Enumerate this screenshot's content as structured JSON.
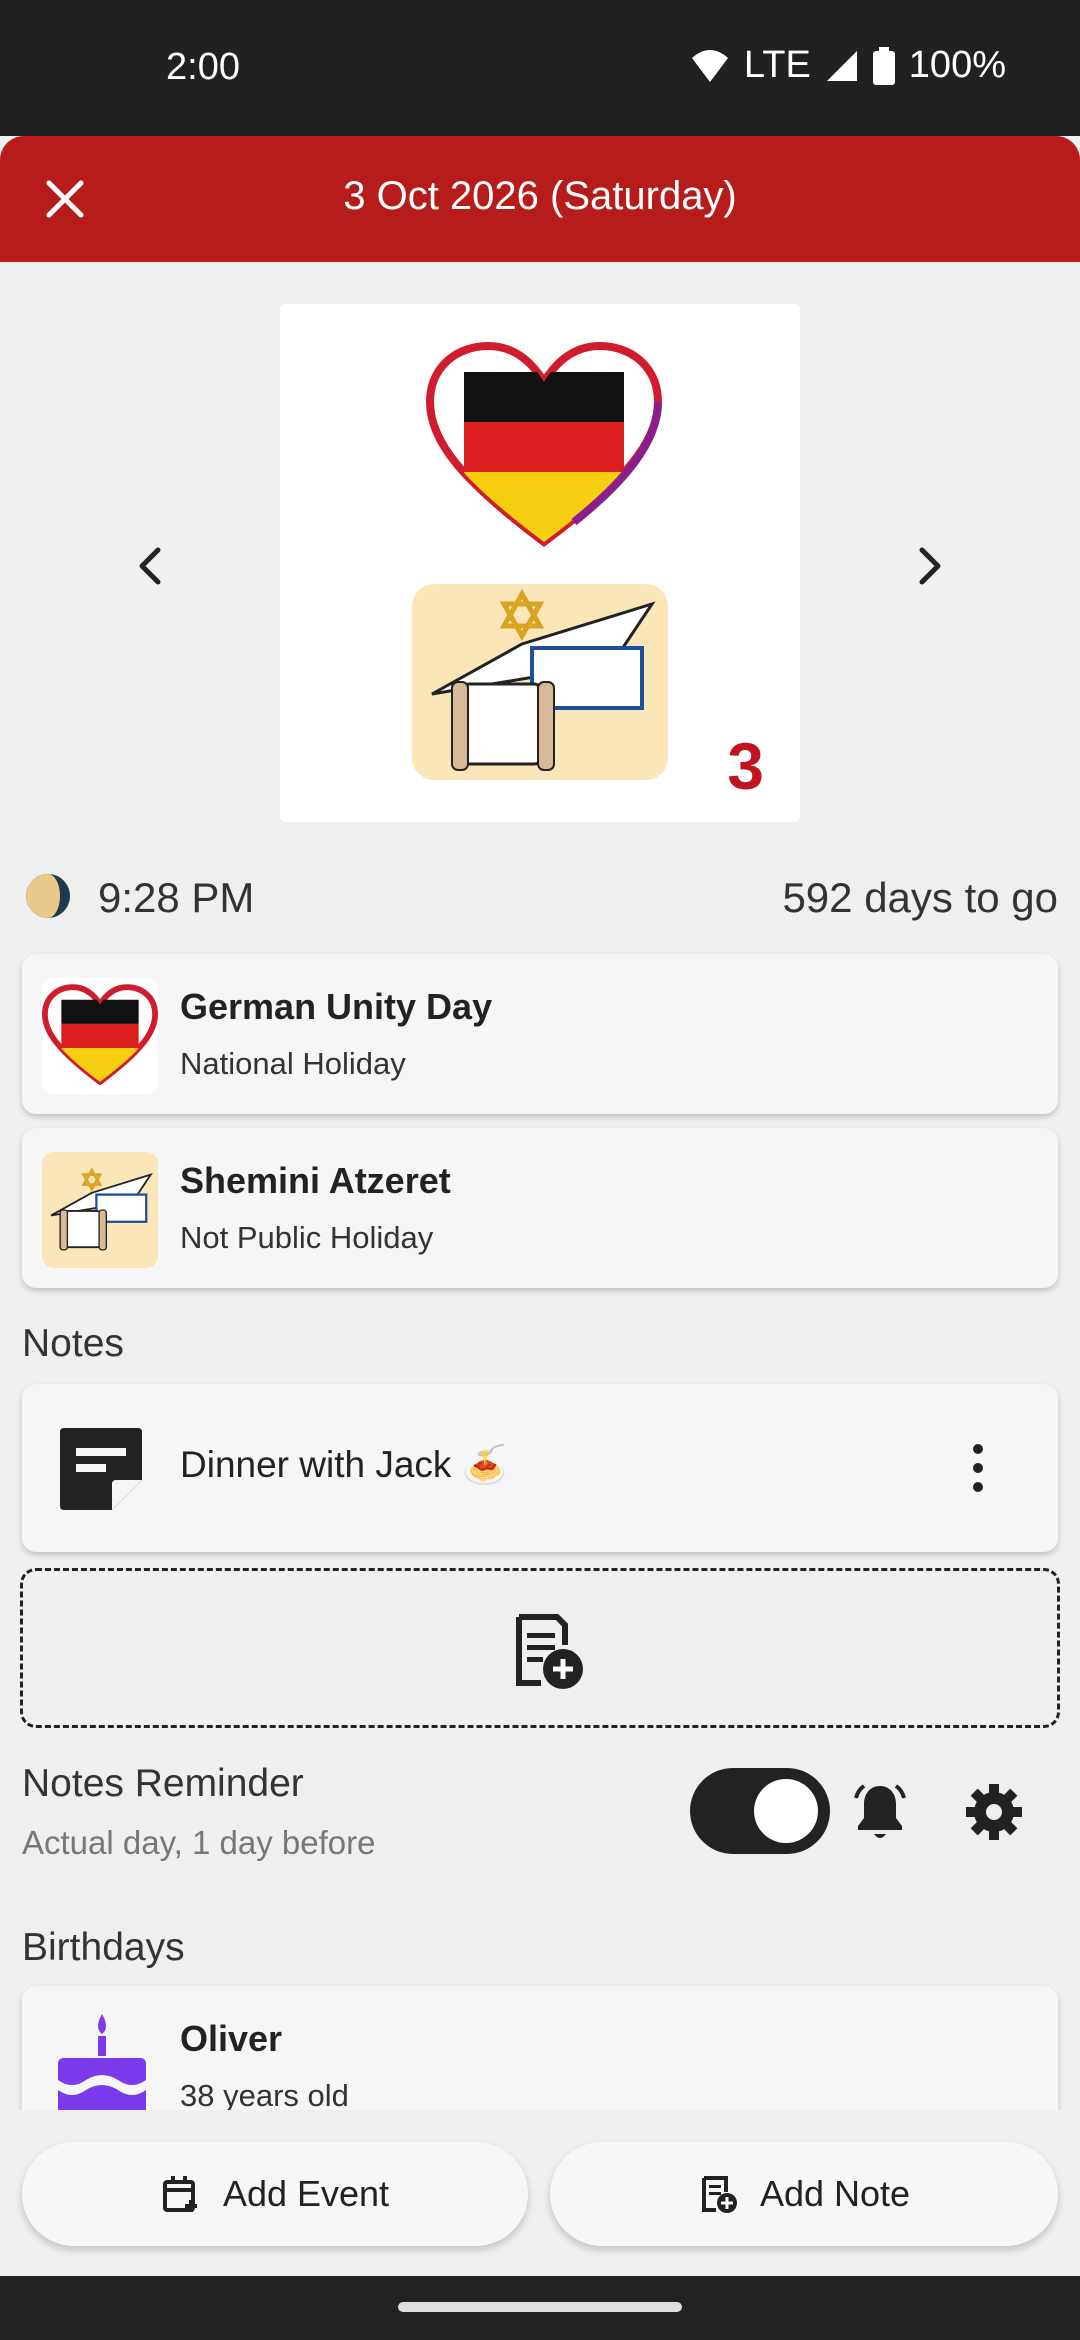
{
  "status_bar": {
    "time": "2:00",
    "network": "LTE",
    "battery": "100%"
  },
  "header": {
    "title": "3 Oct 2026 (Saturday)",
    "close_icon": "close-icon"
  },
  "hero": {
    "count": "3",
    "images": [
      "germany-heart-flag",
      "torah-scroll-star-of-david"
    ]
  },
  "moon": {
    "time": "9:28 PM",
    "countdown": "592 days to go",
    "icon": "moon-phase-icon"
  },
  "events": [
    {
      "title": "German Unity Day",
      "subtitle": "National Holiday"
    },
    {
      "title": "Shemini Atzeret",
      "subtitle": "Not Public Holiday"
    }
  ],
  "notes": {
    "section_title": "Notes",
    "items": [
      {
        "text": "Dinner with Jack 🍝"
      }
    ]
  },
  "reminder": {
    "title": "Notes Reminder",
    "subtitle": "Actual day, 1 day before",
    "enabled": true
  },
  "birthdays": {
    "section_title": "Birthdays",
    "items": [
      {
        "name": "Oliver",
        "age_text": "38 years old"
      }
    ]
  },
  "actions": {
    "add_event": "Add Event",
    "add_note": "Add Note"
  },
  "colors": {
    "app_bar": "#b71c1c",
    "accent_red": "#c1121f",
    "cake_purple": "#7c3aed"
  }
}
